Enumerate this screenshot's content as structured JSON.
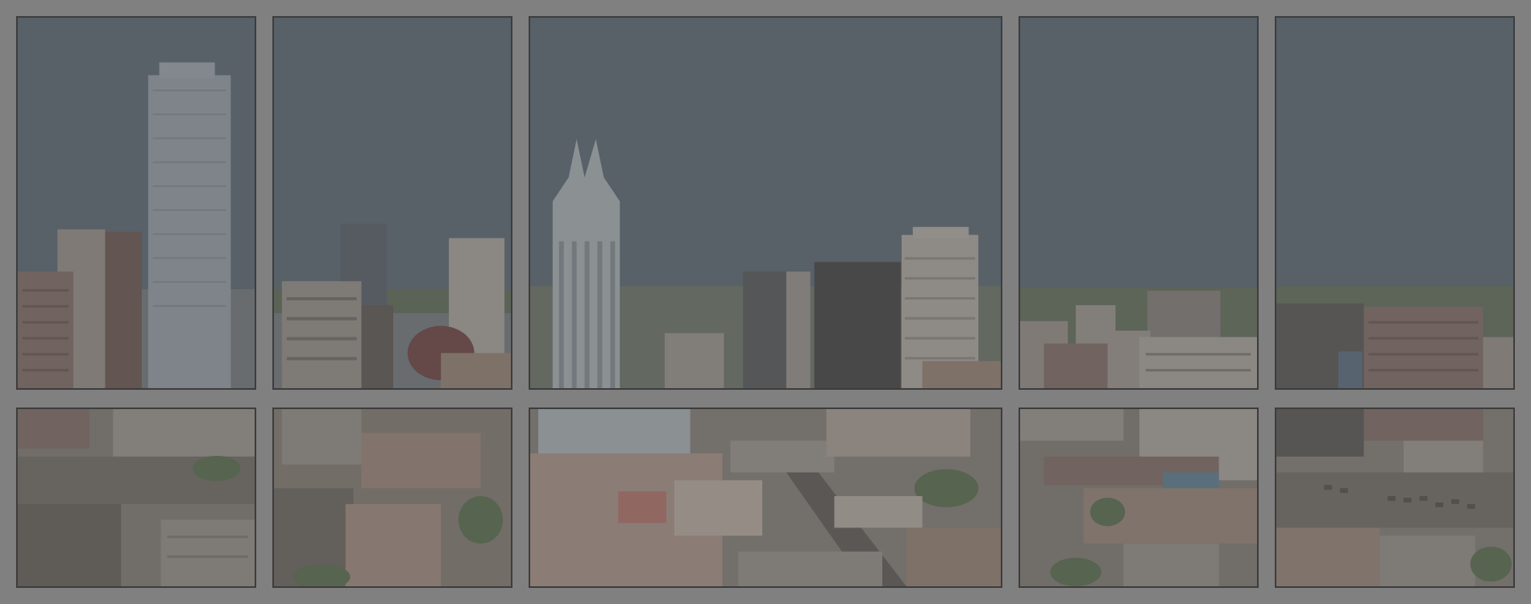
{
  "scene": {
    "description_visible_text": "",
    "colors": {
      "backdrop": "#808080",
      "mullion": "#3d3d3d",
      "sky": "#5c6670",
      "skyline_haze": "#6f7478",
      "tower_glass": "#8a9299",
      "tower_dark": "#4a4a4a",
      "brick": "#7a6a64",
      "concrete": "#8a857f",
      "tree": "#5a6b52"
    }
  },
  "panes": [
    {
      "name": "upper-pane-1"
    },
    {
      "name": "upper-pane-2"
    },
    {
      "name": "upper-pane-3"
    },
    {
      "name": "upper-pane-4"
    },
    {
      "name": "upper-pane-5"
    },
    {
      "name": "lower-pane-1"
    },
    {
      "name": "lower-pane-2"
    },
    {
      "name": "lower-pane-3"
    },
    {
      "name": "lower-pane-4"
    },
    {
      "name": "lower-pane-5"
    }
  ]
}
